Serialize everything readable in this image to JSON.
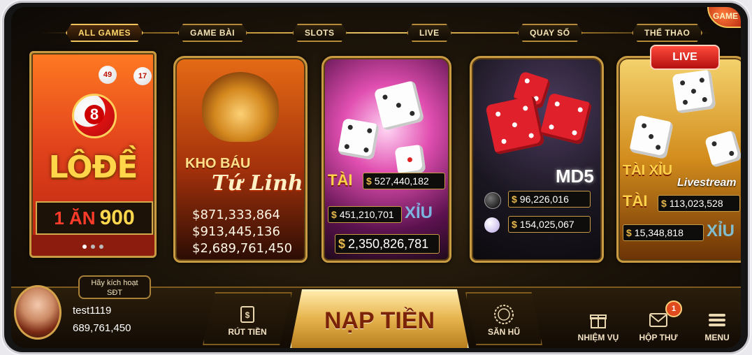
{
  "tabs": [
    {
      "label": "ALL GAMES",
      "active": true
    },
    {
      "label": "GAME BÀI",
      "active": false
    },
    {
      "label": "SLOTS",
      "active": false
    },
    {
      "label": "LIVE",
      "active": false
    },
    {
      "label": "QUAY SỐ",
      "active": false
    },
    {
      "label": "THỂ THAO",
      "active": false
    }
  ],
  "corner_badge": "GAME",
  "cards": {
    "lode": {
      "title": "LÔĐỀ",
      "ball_number": "8",
      "mini_balls": [
        "49",
        "17"
      ],
      "ratio_left": "1 ĂN",
      "ratio_right": "900"
    },
    "khobau": {
      "title_top": "KHO BÁU",
      "title_bottom": "Tứ Linh",
      "amounts": [
        "$871,333,864",
        "$913,445,136",
        "$2,689,761,450"
      ]
    },
    "taixiu": {
      "tai_label": "TÀI",
      "xiu_label": "XỈU",
      "tai_amount": "527,440,182",
      "xiu_amount": "451,210,701",
      "jackpot": "2,350,826,781"
    },
    "md5": {
      "title": "MD5",
      "amount_black": "96,226,016",
      "amount_white": "154,025,067"
    },
    "livestream": {
      "live_badge": "LIVE",
      "title": "TÀI XỈU",
      "subtitle": "Livestream",
      "tai_label": "TÀI",
      "xiu_label": "XỈU",
      "tai_amount": "113,023,528",
      "xiu_amount": "15,348,818"
    }
  },
  "user": {
    "activate_hint_line1": "Hãy kích hoạt",
    "activate_hint_line2": "SĐT",
    "username": "test1119",
    "balance": "689,761,450"
  },
  "nav": {
    "withdraw": "RÚT TIỀN",
    "deposit": "NẠP TIỀN",
    "jackpot_hall": "SĂN HŨ",
    "missions": "NHIỆM VỤ",
    "inbox": "HỘP THƯ",
    "inbox_count": "1",
    "menu": "MENU"
  },
  "colors": {
    "gold": "#c89a41",
    "tab_text": "#f4e3b5",
    "live_red": "#e0202a"
  }
}
